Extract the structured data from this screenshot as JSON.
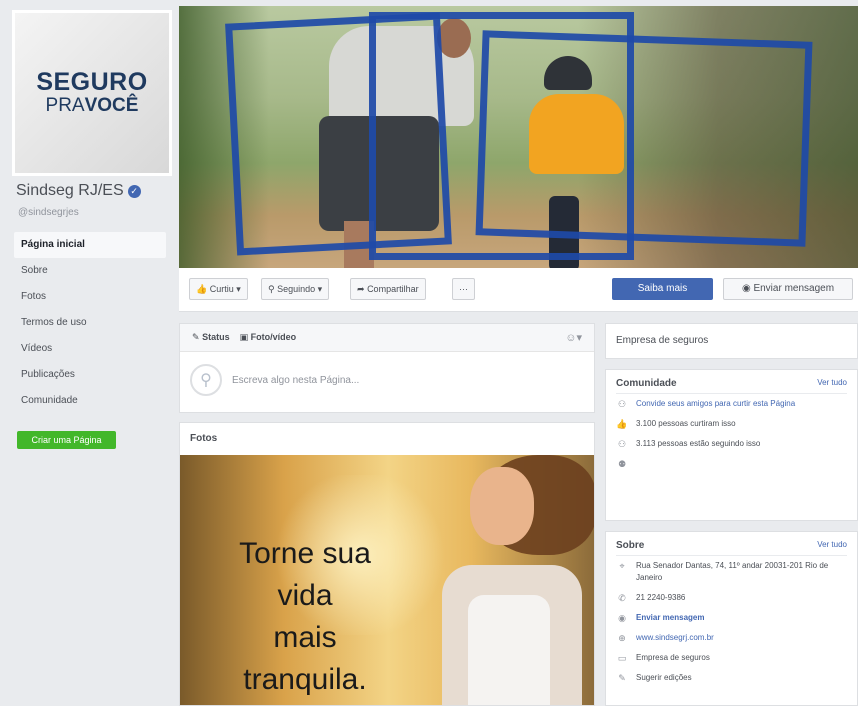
{
  "profile": {
    "logo_line1": "SEGURO",
    "logo_line2_light": "PRA",
    "logo_line2_bold": "VOCÊ",
    "name": "Sindseg RJ/ES",
    "handle": "@sindsegrjes"
  },
  "nav": {
    "items": [
      {
        "label": "Página inicial"
      },
      {
        "label": "Sobre"
      },
      {
        "label": "Fotos"
      },
      {
        "label": "Termos de uso"
      },
      {
        "label": "Vídeos"
      },
      {
        "label": "Publicações"
      },
      {
        "label": "Comunidade"
      }
    ],
    "create_page": "Criar uma Página"
  },
  "actions": {
    "like": "Curtiu ▾",
    "follow": "Seguindo ▾",
    "share": "Compartilhar",
    "more": "···",
    "learn_more": "Saiba mais",
    "send_message": "Enviar mensagem"
  },
  "composer": {
    "status_tab": "Status",
    "photo_tab": "Foto/vídeo",
    "placeholder": "Escreva algo nesta Página..."
  },
  "photos": {
    "title": "Fotos",
    "caption_lines": [
      "Torne sua",
      "vida",
      "mais",
      "tranquila."
    ]
  },
  "right": {
    "category": "Empresa de seguros",
    "community": {
      "title": "Comunidade",
      "see_all": "Ver tudo",
      "invite": "Convide seus amigos para curtir esta Página",
      "likes": "3.100 pessoas curtiram isso",
      "follows": "3.113 pessoas estão seguindo isso"
    },
    "about": {
      "title": "Sobre",
      "see_all": "Ver tudo",
      "address": "Rua Senador Dantas, 74, 11º andar 20031-201 Rio de Janeiro",
      "phone": "21 2240-9386",
      "message": "Enviar mensagem",
      "website": "www.sindsegrj.com.br",
      "category": "Empresa de seguros",
      "edits": "Sugerir edições"
    }
  }
}
